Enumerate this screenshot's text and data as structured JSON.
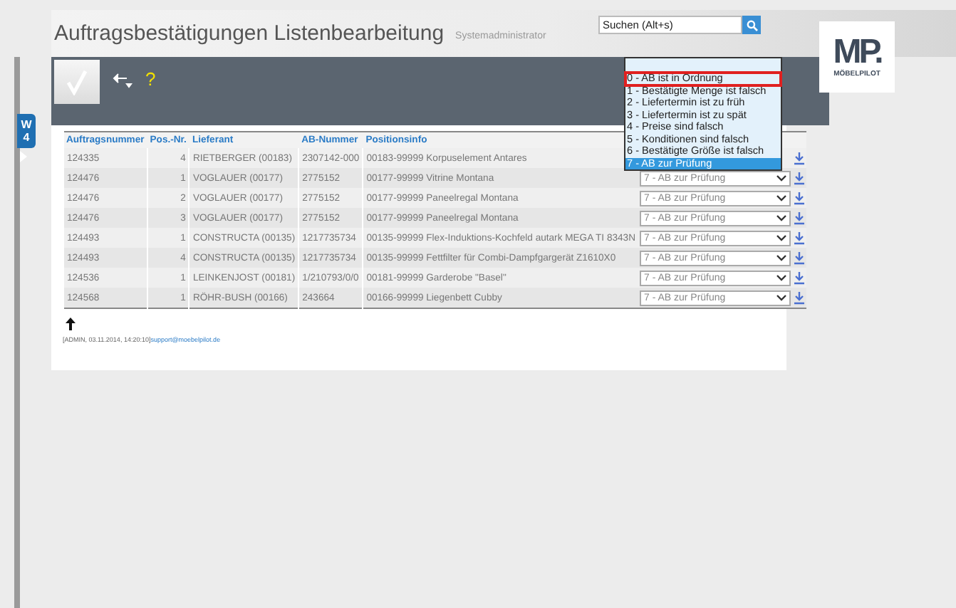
{
  "header": {
    "title": "Auftragsbestätigungen Listenbearbeitung",
    "user": "Systemadministrator",
    "search": {
      "placeholder": "Suchen (Alt+s)"
    }
  },
  "logo": {
    "mark": "MP.",
    "name": "MÖBELPILOT"
  },
  "toolbar": {
    "help": "?"
  },
  "side_tab": {
    "label": "W 4"
  },
  "table": {
    "columns": [
      "Auftragsnummer",
      "Pos.-Nr.",
      "Lieferant",
      "AB-Nummer",
      "Positionsinfo"
    ],
    "rows": [
      {
        "cells": [
          "124335",
          "4",
          "RIETBERGER (00183)",
          "2307142-000",
          "00183-99999 Korpuselement Antares"
        ]
      },
      {
        "cells": [
          "124476",
          "1",
          "VOGLAUER (00177)",
          "2775152",
          "00177-99999 Vitrine Montana"
        ],
        "status": "7 - AB zur Prüfung"
      },
      {
        "cells": [
          "124476",
          "2",
          "VOGLAUER (00177)",
          "2775152",
          "00177-99999 Paneelregal Montana"
        ],
        "status": "7 - AB zur Prüfung"
      },
      {
        "cells": [
          "124476",
          "3",
          "VOGLAUER (00177)",
          "2775152",
          "00177-99999 Paneelregal Montana"
        ],
        "status": "7 - AB zur Prüfung"
      },
      {
        "cells": [
          "124493",
          "1",
          "CONSTRUCTA (00135)",
          "1217735734",
          "00135-99999 Flex-Induktions-Kochfeld autark MEGA TI 8343N"
        ],
        "status": "7 - AB zur Prüfung"
      },
      {
        "cells": [
          "124493",
          "4",
          "CONSTRUCTA (00135)",
          "1217735734",
          "00135-99999 Fettfilter für Combi-Dampfgargerät Z1610X0"
        ],
        "status": "7 - AB zur Prüfung"
      },
      {
        "cells": [
          "124536",
          "1",
          "LEINKENJOST (00181)",
          "1/210793/0/0",
          "00181-99999 Garderobe \"Basel\""
        ],
        "status": "7 - AB zur Prüfung"
      },
      {
        "cells": [
          "124568",
          "1",
          "RÖHR-BUSH (00166)",
          "243664",
          "00166-99999 Liegenbett Cubby"
        ],
        "status": "7 - AB zur Prüfung"
      }
    ]
  },
  "dropdown": {
    "options": [
      {
        "label": "0 - AB ist in Ordnung",
        "selected": false,
        "marked": true
      },
      {
        "label": "1 - Bestätigte Menge ist falsch",
        "selected": false,
        "marked": false
      },
      {
        "label": "2 - Liefertermin ist zu früh",
        "selected": false,
        "marked": false
      },
      {
        "label": "3 - Liefertermin ist zu spät",
        "selected": false,
        "marked": false
      },
      {
        "label": "4 - Preise sind falsch",
        "selected": false,
        "marked": false
      },
      {
        "label": "5 - Konditionen sind falsch",
        "selected": false,
        "marked": false
      },
      {
        "label": "6 - Bestätigte Größe ist falsch",
        "selected": false,
        "marked": false
      },
      {
        "label": "7 - AB zur Prüfung",
        "selected": true,
        "marked": false
      }
    ]
  },
  "footer": {
    "info": "[ADMIN, 03.11.2014, 14:20:10]",
    "link": "support@moebelpilot.de"
  }
}
